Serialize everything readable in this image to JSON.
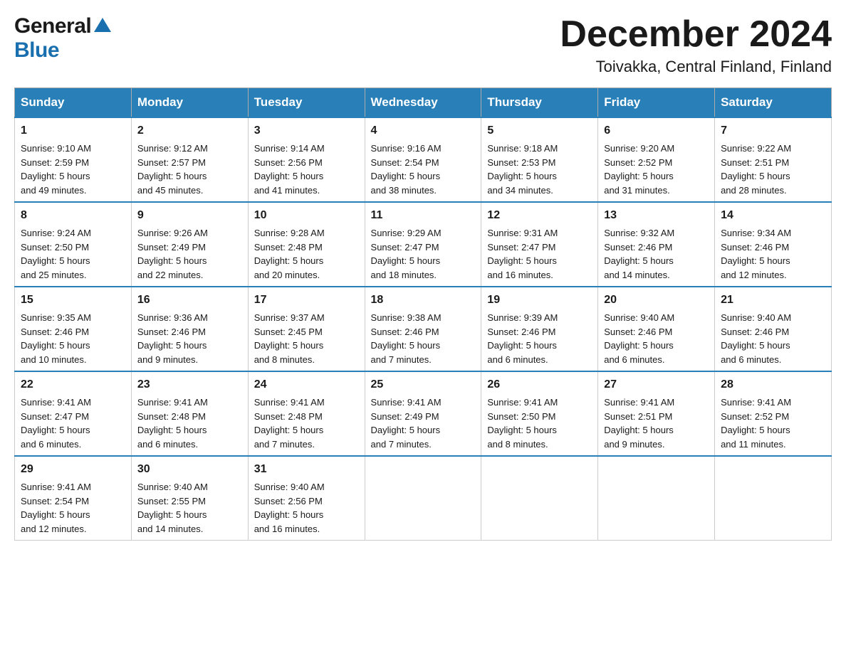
{
  "header": {
    "logo_general": "General",
    "logo_blue": "Blue",
    "title": "December 2024",
    "subtitle": "Toivakka, Central Finland, Finland"
  },
  "calendar": {
    "days_of_week": [
      "Sunday",
      "Monday",
      "Tuesday",
      "Wednesday",
      "Thursday",
      "Friday",
      "Saturday"
    ],
    "weeks": [
      [
        {
          "day": "1",
          "sunrise": "9:10 AM",
          "sunset": "2:59 PM",
          "daylight": "5 hours and 49 minutes."
        },
        {
          "day": "2",
          "sunrise": "9:12 AM",
          "sunset": "2:57 PM",
          "daylight": "5 hours and 45 minutes."
        },
        {
          "day": "3",
          "sunrise": "9:14 AM",
          "sunset": "2:56 PM",
          "daylight": "5 hours and 41 minutes."
        },
        {
          "day": "4",
          "sunrise": "9:16 AM",
          "sunset": "2:54 PM",
          "daylight": "5 hours and 38 minutes."
        },
        {
          "day": "5",
          "sunrise": "9:18 AM",
          "sunset": "2:53 PM",
          "daylight": "5 hours and 34 minutes."
        },
        {
          "day": "6",
          "sunrise": "9:20 AM",
          "sunset": "2:52 PM",
          "daylight": "5 hours and 31 minutes."
        },
        {
          "day": "7",
          "sunrise": "9:22 AM",
          "sunset": "2:51 PM",
          "daylight": "5 hours and 28 minutes."
        }
      ],
      [
        {
          "day": "8",
          "sunrise": "9:24 AM",
          "sunset": "2:50 PM",
          "daylight": "5 hours and 25 minutes."
        },
        {
          "day": "9",
          "sunrise": "9:26 AM",
          "sunset": "2:49 PM",
          "daylight": "5 hours and 22 minutes."
        },
        {
          "day": "10",
          "sunrise": "9:28 AM",
          "sunset": "2:48 PM",
          "daylight": "5 hours and 20 minutes."
        },
        {
          "day": "11",
          "sunrise": "9:29 AM",
          "sunset": "2:47 PM",
          "daylight": "5 hours and 18 minutes."
        },
        {
          "day": "12",
          "sunrise": "9:31 AM",
          "sunset": "2:47 PM",
          "daylight": "5 hours and 16 minutes."
        },
        {
          "day": "13",
          "sunrise": "9:32 AM",
          "sunset": "2:46 PM",
          "daylight": "5 hours and 14 minutes."
        },
        {
          "day": "14",
          "sunrise": "9:34 AM",
          "sunset": "2:46 PM",
          "daylight": "5 hours and 12 minutes."
        }
      ],
      [
        {
          "day": "15",
          "sunrise": "9:35 AM",
          "sunset": "2:46 PM",
          "daylight": "5 hours and 10 minutes."
        },
        {
          "day": "16",
          "sunrise": "9:36 AM",
          "sunset": "2:46 PM",
          "daylight": "5 hours and 9 minutes."
        },
        {
          "day": "17",
          "sunrise": "9:37 AM",
          "sunset": "2:45 PM",
          "daylight": "5 hours and 8 minutes."
        },
        {
          "day": "18",
          "sunrise": "9:38 AM",
          "sunset": "2:46 PM",
          "daylight": "5 hours and 7 minutes."
        },
        {
          "day": "19",
          "sunrise": "9:39 AM",
          "sunset": "2:46 PM",
          "daylight": "5 hours and 6 minutes."
        },
        {
          "day": "20",
          "sunrise": "9:40 AM",
          "sunset": "2:46 PM",
          "daylight": "5 hours and 6 minutes."
        },
        {
          "day": "21",
          "sunrise": "9:40 AM",
          "sunset": "2:46 PM",
          "daylight": "5 hours and 6 minutes."
        }
      ],
      [
        {
          "day": "22",
          "sunrise": "9:41 AM",
          "sunset": "2:47 PM",
          "daylight": "5 hours and 6 minutes."
        },
        {
          "day": "23",
          "sunrise": "9:41 AM",
          "sunset": "2:48 PM",
          "daylight": "5 hours and 6 minutes."
        },
        {
          "day": "24",
          "sunrise": "9:41 AM",
          "sunset": "2:48 PM",
          "daylight": "5 hours and 7 minutes."
        },
        {
          "day": "25",
          "sunrise": "9:41 AM",
          "sunset": "2:49 PM",
          "daylight": "5 hours and 7 minutes."
        },
        {
          "day": "26",
          "sunrise": "9:41 AM",
          "sunset": "2:50 PM",
          "daylight": "5 hours and 8 minutes."
        },
        {
          "day": "27",
          "sunrise": "9:41 AM",
          "sunset": "2:51 PM",
          "daylight": "5 hours and 9 minutes."
        },
        {
          "day": "28",
          "sunrise": "9:41 AM",
          "sunset": "2:52 PM",
          "daylight": "5 hours and 11 minutes."
        }
      ],
      [
        {
          "day": "29",
          "sunrise": "9:41 AM",
          "sunset": "2:54 PM",
          "daylight": "5 hours and 12 minutes."
        },
        {
          "day": "30",
          "sunrise": "9:40 AM",
          "sunset": "2:55 PM",
          "daylight": "5 hours and 14 minutes."
        },
        {
          "day": "31",
          "sunrise": "9:40 AM",
          "sunset": "2:56 PM",
          "daylight": "5 hours and 16 minutes."
        },
        null,
        null,
        null,
        null
      ]
    ]
  }
}
